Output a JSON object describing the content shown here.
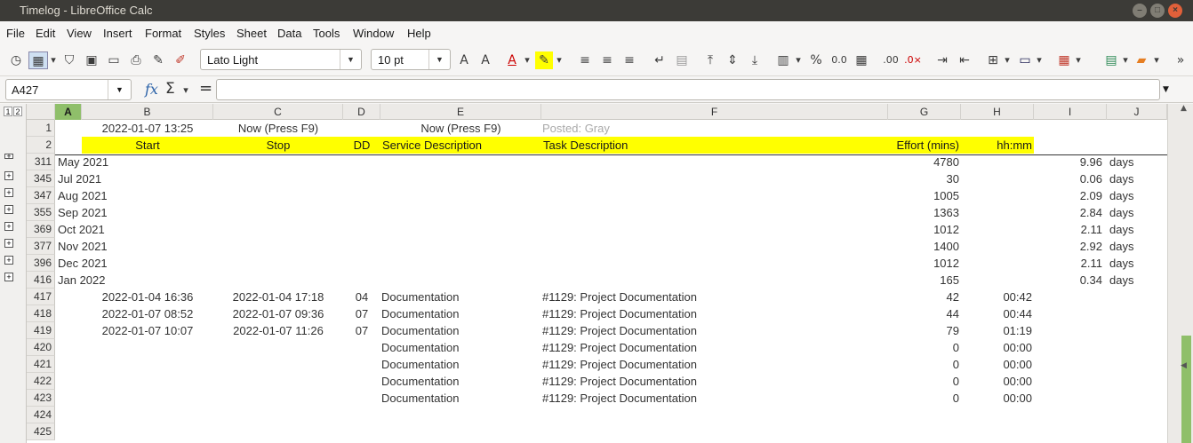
{
  "window": {
    "title": "Timelog - LibreOffice Calc"
  },
  "menu": [
    "File",
    "Edit",
    "View",
    "Insert",
    "Format",
    "Styles",
    "Sheet",
    "Data",
    "Tools",
    "Window",
    "Help"
  ],
  "toolbar": {
    "font_name": "Lato Light",
    "font_size": "10 pt",
    "percent": "%",
    "decimal": "0.0"
  },
  "formula": {
    "name_box": "A427",
    "fx": "fx",
    "sigma": "Σ",
    "eq": "=",
    "content": ""
  },
  "outline_levels": [
    "1",
    "2"
  ],
  "columns": [
    "A",
    "B",
    "C",
    "D",
    "E",
    "F",
    "G",
    "H",
    "I",
    "J"
  ],
  "selected_column": "A",
  "rows": [
    {
      "num": "1",
      "b": "2022-01-07 13:25",
      "c": "Now (Press F9)",
      "e": "Now (Press F9)",
      "f": "Posted: Gray"
    },
    {
      "num": "2",
      "b": "Start",
      "c": "Stop",
      "d": "DD",
      "e": "Service Description",
      "f": "Task Description",
      "g": "Effort (mins)",
      "h": "hh:mm"
    },
    {
      "num": "311",
      "a": "May 2021",
      "g": "4780",
      "i": "9.96",
      "j": "days"
    },
    {
      "num": "345",
      "a": "Jul 2021",
      "g": "30",
      "i": "0.06",
      "j": "days"
    },
    {
      "num": "347",
      "a": "Aug 2021",
      "g": "1005",
      "i": "2.09",
      "j": "days"
    },
    {
      "num": "355",
      "a": "Sep 2021",
      "g": "1363",
      "i": "2.84",
      "j": "days"
    },
    {
      "num": "369",
      "a": "Oct 2021",
      "g": "1012",
      "i": "2.11",
      "j": "days"
    },
    {
      "num": "377",
      "a": "Nov 2021",
      "g": "1400",
      "i": "2.92",
      "j": "days"
    },
    {
      "num": "396",
      "a": "Dec 2021",
      "g": "1012",
      "i": "2.11",
      "j": "days"
    },
    {
      "num": "416",
      "a": "Jan 2022",
      "g": "165",
      "i": "0.34",
      "j": "days"
    },
    {
      "num": "417",
      "b": "2022-01-04 16:36",
      "c": "2022-01-04 17:18",
      "d": "04",
      "e": "Documentation",
      "f": "#1129: Project Documentation",
      "g": "42",
      "h": "00:42"
    },
    {
      "num": "418",
      "b": "2022-01-07 08:52",
      "c": "2022-01-07 09:36",
      "d": "07",
      "e": "Documentation",
      "f": "#1129: Project Documentation",
      "g": "44",
      "h": "00:44"
    },
    {
      "num": "419",
      "b": "2022-01-07 10:07",
      "c": "2022-01-07 11:26",
      "d": "07",
      "e": "Documentation",
      "f": "#1129: Project Documentation",
      "g": "79",
      "h": "01:19"
    },
    {
      "num": "420",
      "e": "Documentation",
      "f": "#1129: Project Documentation",
      "g": "0",
      "h": "00:00"
    },
    {
      "num": "421",
      "e": "Documentation",
      "f": "#1129: Project Documentation",
      "g": "0",
      "h": "00:00"
    },
    {
      "num": "422",
      "e": "Documentation",
      "f": "#1129: Project Documentation",
      "g": "0",
      "h": "00:00"
    },
    {
      "num": "423",
      "e": "Documentation",
      "f": "#1129: Project Documentation",
      "g": "0",
      "h": "00:00"
    },
    {
      "num": "424"
    },
    {
      "num": "425"
    }
  ],
  "colors": {
    "header_band": "#ffff00",
    "selected_col": "#8fbf6a",
    "posted_text": "#aaaaaa"
  }
}
